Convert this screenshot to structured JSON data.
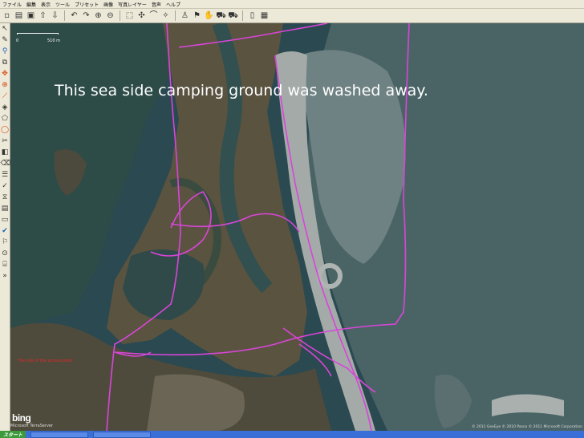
{
  "menu": {
    "items": [
      "ファイル",
      "編集",
      "表示",
      "ツール",
      "プリセット",
      "画像",
      "写真レイヤー",
      "音声",
      "ヘルプ"
    ]
  },
  "toolbar": {
    "buttons": [
      {
        "name": "new-file-icon",
        "glyph": "▫"
      },
      {
        "name": "open-file-icon",
        "glyph": "▤"
      },
      {
        "name": "save-icon",
        "glyph": "▣"
      },
      {
        "name": "upload-icon",
        "glyph": "⇧"
      },
      {
        "name": "download-icon",
        "glyph": "⇩"
      },
      {
        "name": "undo-icon",
        "glyph": "↶"
      },
      {
        "name": "redo-icon",
        "glyph": "↷"
      },
      {
        "name": "zoom-in-icon",
        "glyph": "⊕"
      },
      {
        "name": "zoom-out-icon",
        "glyph": "⊖"
      },
      {
        "name": "select-icon",
        "glyph": "⬚"
      },
      {
        "name": "move-icon",
        "glyph": "✣"
      },
      {
        "name": "lasso-icon",
        "glyph": "⌒"
      },
      {
        "name": "wand-icon",
        "glyph": "✧"
      },
      {
        "name": "person-icon",
        "glyph": "♙"
      },
      {
        "name": "flag-icon",
        "glyph": "⚑"
      },
      {
        "name": "hand-icon",
        "glyph": "✋"
      },
      {
        "name": "car-icon",
        "glyph": "⛟"
      },
      {
        "name": "car-alt-icon",
        "glyph": "⛟"
      },
      {
        "name": "page-icon",
        "glyph": "▯"
      },
      {
        "name": "grid-icon",
        "glyph": "▦"
      }
    ]
  },
  "leftbar": {
    "tools": [
      {
        "name": "pointer-tool-icon",
        "glyph": "↖",
        "tone": ""
      },
      {
        "name": "pencil-tool-icon",
        "glyph": "✎",
        "tone": ""
      },
      {
        "name": "zoom-tool-icon",
        "glyph": "⚲",
        "tone": "blue"
      },
      {
        "name": "layer-tool-icon",
        "glyph": "⧉",
        "tone": ""
      },
      {
        "name": "move-tool-icon",
        "glyph": "✥",
        "tone": "accent"
      },
      {
        "name": "crosshair-tool-icon",
        "glyph": "⊕",
        "tone": "accent"
      },
      {
        "name": "path-tool-icon",
        "glyph": "⟋",
        "tone": "accent"
      },
      {
        "name": "node-tool-icon",
        "glyph": "◈",
        "tone": ""
      },
      {
        "name": "polygon-tool-icon",
        "glyph": "⬠",
        "tone": ""
      },
      {
        "name": "ellipse-tool-icon",
        "glyph": "◯",
        "tone": "accent"
      },
      {
        "name": "cut-tool-icon",
        "glyph": "✂",
        "tone": ""
      },
      {
        "name": "fill-tool-icon",
        "glyph": "◧",
        "tone": ""
      },
      {
        "name": "erase-tool-icon",
        "glyph": "⌫",
        "tone": ""
      },
      {
        "name": "properties-tool-icon",
        "glyph": "☰",
        "tone": ""
      },
      {
        "name": "mark-tool-icon",
        "glyph": "✓",
        "tone": ""
      },
      {
        "name": "filter-tool-icon",
        "glyph": "⧖",
        "tone": ""
      },
      {
        "name": "stamp-tool-icon",
        "glyph": "▤",
        "tone": ""
      },
      {
        "name": "frame-tool-icon",
        "glyph": "▭",
        "tone": ""
      },
      {
        "name": "check-tool-icon",
        "glyph": "✔",
        "tone": "blue"
      },
      {
        "name": "tag-tool-icon",
        "glyph": "⚐",
        "tone": ""
      },
      {
        "name": "compass-tool-icon",
        "glyph": "⊙",
        "tone": ""
      },
      {
        "name": "ruler-tool-icon",
        "glyph": "⌸",
        "tone": ""
      },
      {
        "name": "expand-icon",
        "glyph": "»",
        "tone": ""
      }
    ]
  },
  "map": {
    "caption": "This sea side camping ground was washed away.",
    "scale": {
      "zero": "0",
      "length": "510 m"
    },
    "red_note": "The site of the access point",
    "bing_logo": "bing",
    "bing_credit": "Microsoft TerraServer",
    "copyright": "© 2011 GeoEye © 2010 Pasco © 2011 Microsoft Corporation",
    "colors": {
      "water": "#2b4a50",
      "land": "#58503d",
      "beach": "#9aa3a3",
      "track": "#d945d9"
    }
  },
  "taskbar": {
    "start_label": "スタート"
  }
}
